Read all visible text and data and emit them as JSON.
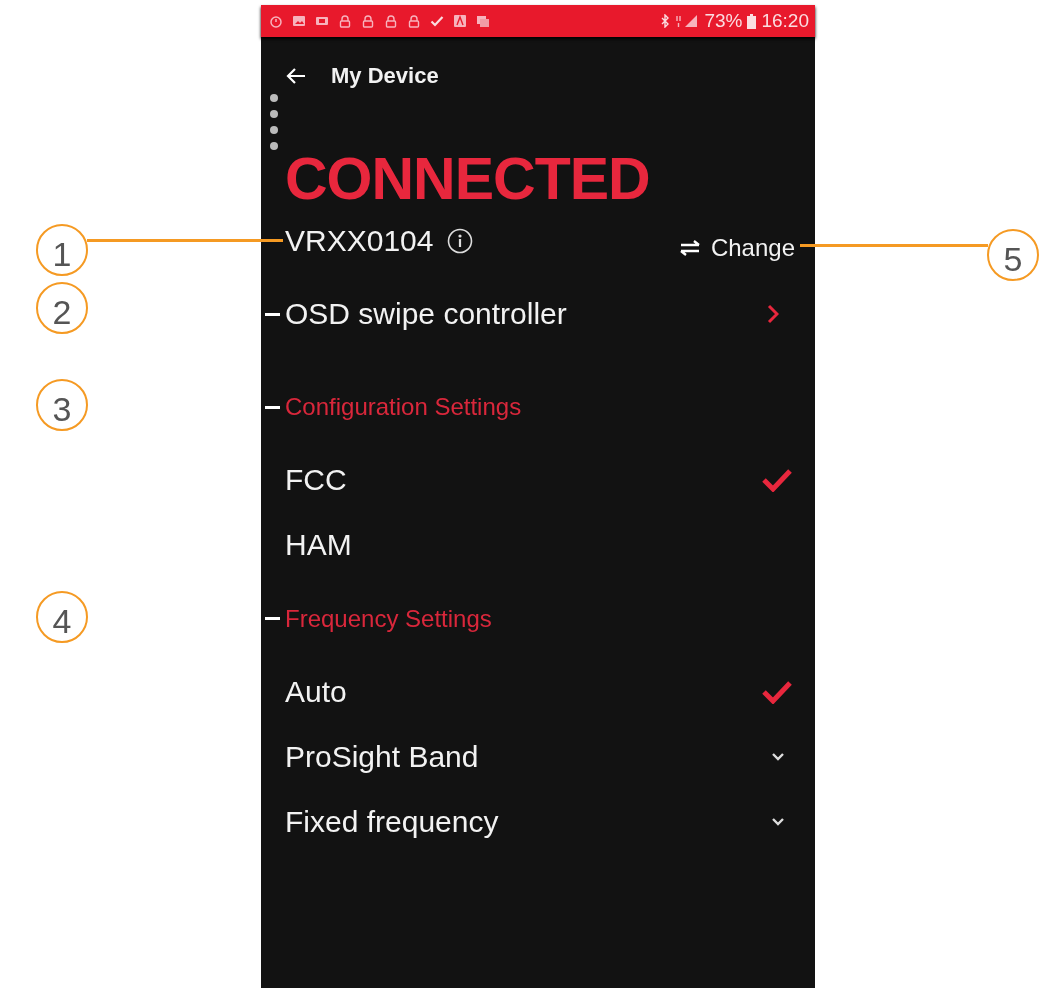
{
  "status_bar": {
    "battery": "73%",
    "time": "16:20"
  },
  "header": {
    "title": "My Device"
  },
  "connection": {
    "status": "CONNECTED",
    "device": "VRXX0104",
    "change": "Change"
  },
  "menu": [
    {
      "label": "OSD swipe controller"
    }
  ],
  "sections": [
    {
      "title": "Configuration Settings",
      "options": [
        {
          "label": "FCC",
          "kind": "choice",
          "selected": true
        },
        {
          "label": "HAM",
          "kind": "choice",
          "selected": false
        }
      ]
    },
    {
      "title": "Frequency Settings",
      "options": [
        {
          "label": "Auto",
          "kind": "choice",
          "selected": true
        },
        {
          "label": "ProSight Band",
          "kind": "expandable",
          "selected": false
        },
        {
          "label": "Fixed frequency",
          "kind": "expandable",
          "selected": false
        }
      ]
    }
  ],
  "callouts": [
    {
      "number": "1"
    },
    {
      "number": "2"
    },
    {
      "number": "3"
    },
    {
      "number": "4"
    },
    {
      "number": "5"
    }
  ]
}
